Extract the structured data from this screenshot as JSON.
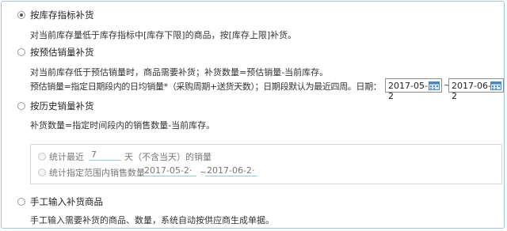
{
  "options": {
    "by_stock_index": {
      "label": "按库存指标补货",
      "desc": "对当前库存量低于库存指标中[库存下限]的商品，按[库存上限]补货。",
      "selected": true
    },
    "by_forecast": {
      "label": "按预估销量补货",
      "desc1": "对当前库存低于预估销量时，商品需要补货；补货数量=预估销量-当前库存。",
      "desc2": "预估销量=指定日期段内的日均销量*（采购周期+送货天数）；日期段默认为最近四周。日期：",
      "date_from": "2017-05-2",
      "date_sep": "~",
      "date_to": "2017-06-2",
      "selected": false
    },
    "by_history": {
      "label": "按历史销量补货",
      "desc": "补货数量=指定时间段内的销售数量-当前库存。",
      "selected": false,
      "sub": {
        "recent_prefix": "统计最近",
        "recent_days": "7",
        "recent_suffix": "天（不含当天）的销量",
        "range_label": "统计指定范围内销售数量",
        "range_from": "2017-05-2·",
        "range_sep": "~",
        "range_to": "2017-06-2·"
      }
    },
    "manual": {
      "label": "手工输入补货商品",
      "desc": "手工输入需要补货的商品、数量，系统自动按供应商生成单据。",
      "selected": false
    }
  },
  "colors": {
    "border": "#9fc3e7",
    "calendar_icon": "#4a86c5"
  }
}
